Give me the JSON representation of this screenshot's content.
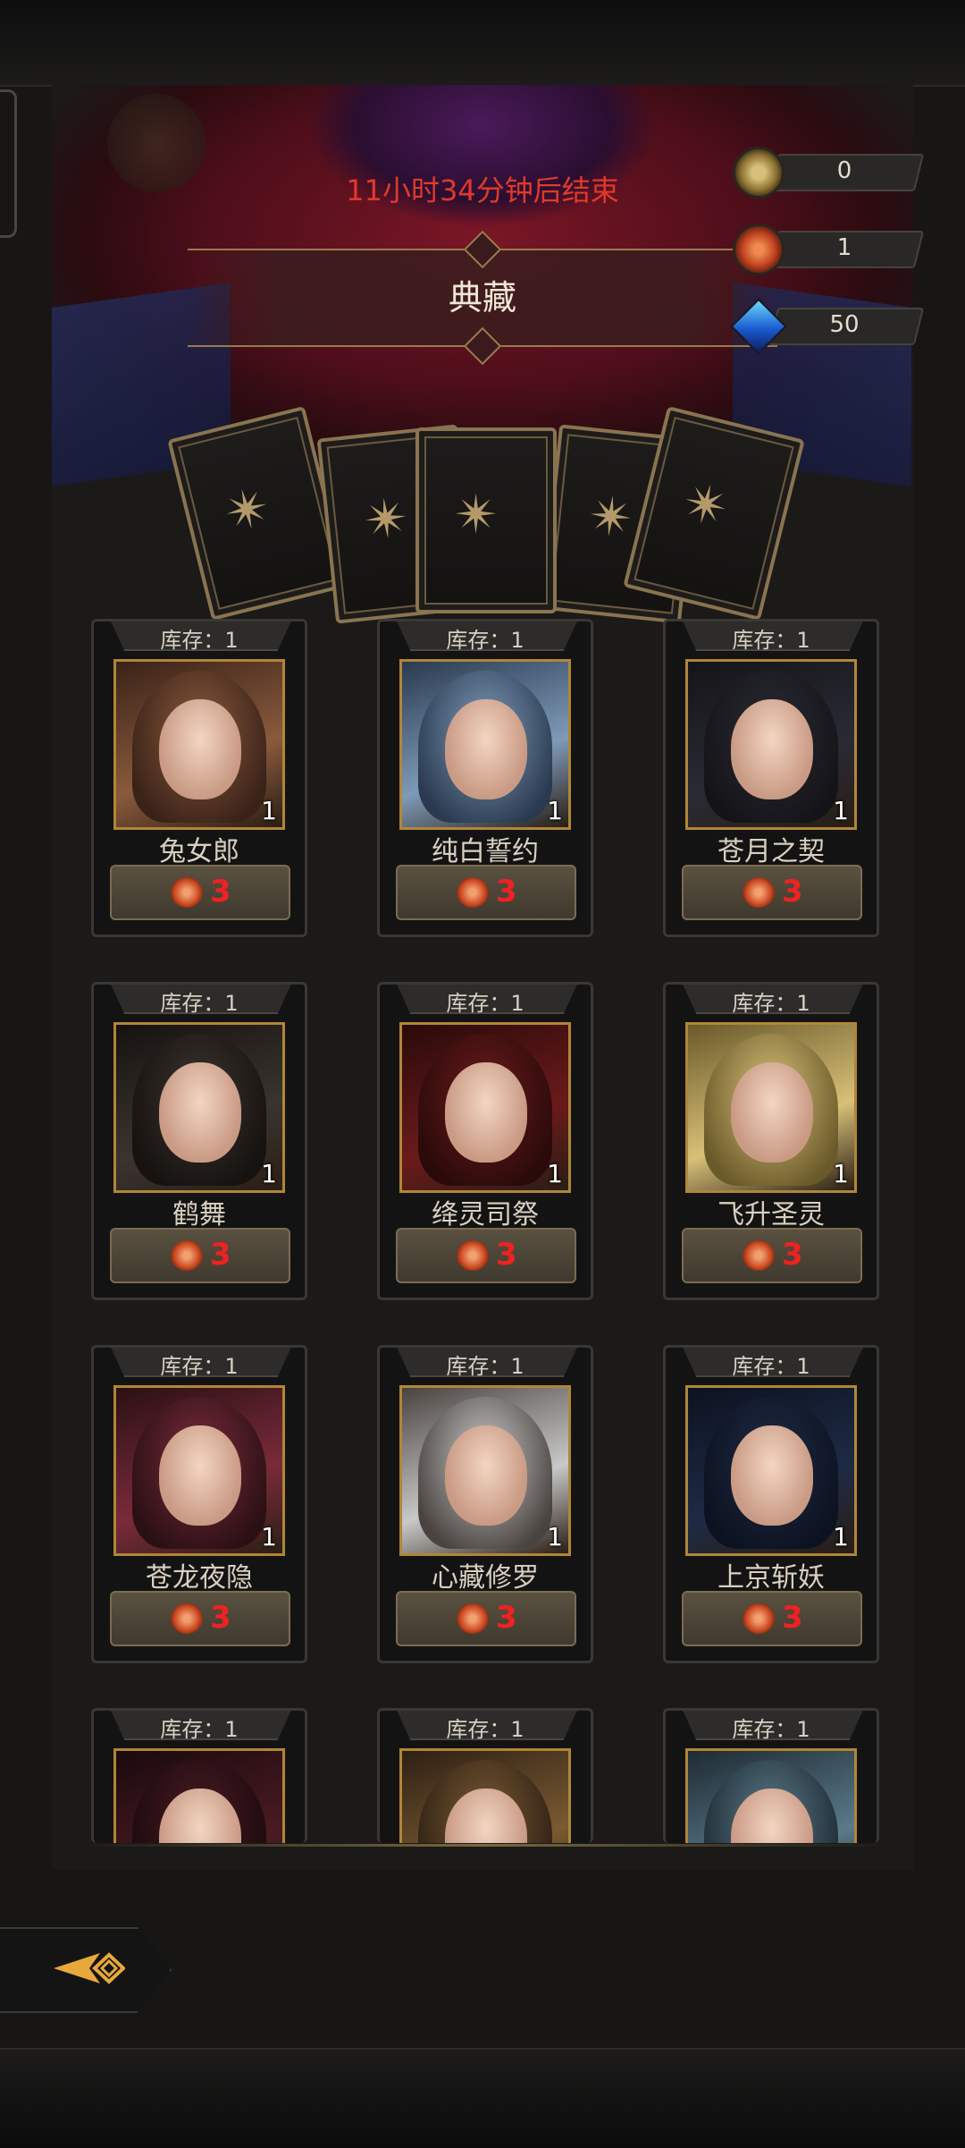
{
  "event": {
    "timer_text": "11小时34分钟后结束",
    "title": "典藏"
  },
  "currencies": [
    {
      "icon": "gold-coin-icon",
      "value": "0"
    },
    {
      "icon": "red-coin-icon",
      "value": "1"
    },
    {
      "icon": "blue-crystal-icon",
      "value": "50"
    }
  ],
  "items": [
    {
      "stock": "库存：1",
      "name": "兔女郎",
      "count": "1",
      "price": "3"
    },
    {
      "stock": "库存：1",
      "name": "纯白誓约",
      "count": "1",
      "price": "3"
    },
    {
      "stock": "库存：1",
      "name": "苍月之契",
      "count": "1",
      "price": "3"
    },
    {
      "stock": "库存：1",
      "name": "鹤舞",
      "count": "1",
      "price": "3"
    },
    {
      "stock": "库存：1",
      "name": "绛灵司祭",
      "count": "1",
      "price": "3"
    },
    {
      "stock": "库存：1",
      "name": "飞升圣灵",
      "count": "1",
      "price": "3"
    },
    {
      "stock": "库存：1",
      "name": "苍龙夜隐",
      "count": "1",
      "price": "3"
    },
    {
      "stock": "库存：1",
      "name": "心藏修罗",
      "count": "1",
      "price": "3"
    },
    {
      "stock": "库存：1",
      "name": "上京斩妖",
      "count": "1",
      "price": "3"
    },
    {
      "stock": "库存：1"
    },
    {
      "stock": "库存：1"
    },
    {
      "stock": "库存：1"
    }
  ],
  "colors": {
    "timer": "#e2392b",
    "price": "#ee2222",
    "portrait_border": "#b08636"
  }
}
